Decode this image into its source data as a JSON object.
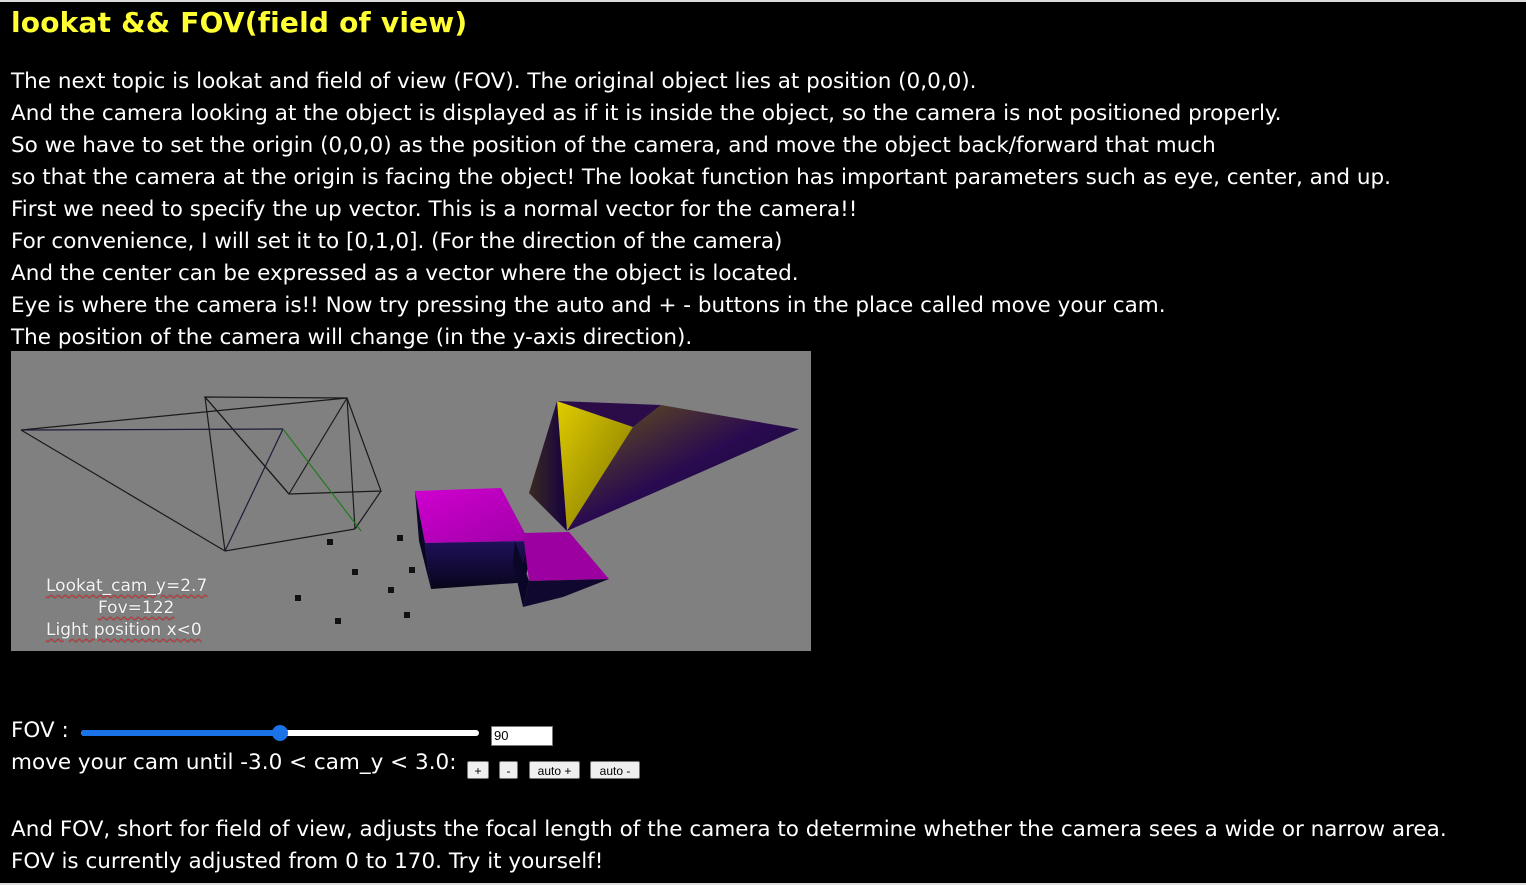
{
  "title": "lookat && FOV(field of view)",
  "intro_lines": [
    "The next topic is lookat and field of view (FOV). The original object lies at position (0,0,0).",
    "And the camera looking at the object is displayed as if it is inside the object, so the camera is not positioned properly.",
    "So we have to set the origin (0,0,0) as the position of the camera, and move the object back/forward that much",
    "so that the camera at the origin is facing the object! The lookat function has important parameters such as eye, center, and up.",
    "First we need to specify the up vector. This is a normal vector for the camera!!",
    "For convenience, I will set it to [0,1,0]. (For the direction of the camera)",
    "And the center can be expressed as a vector where the object is located.",
    "Eye is where the camera is!! Now try pressing the auto and + - buttons in the place called move your cam.",
    "The position of the camera will change (in the y-axis direction)."
  ],
  "canvas": {
    "overlay": {
      "cam_label": "Lookat_cam_y=2.7",
      "fov_label": "Fov=122",
      "light_label": "Light position x<0"
    }
  },
  "controls": {
    "fov_label": "FOV :",
    "fov_value": "90",
    "fov_min": 0,
    "fov_max": 170,
    "fov_slider_fraction": 0.5,
    "cam_label": "move your cam until -3.0 < cam_y < 3.0:",
    "plus_label": "+",
    "minus_label": "-",
    "auto_plus_label": "auto +",
    "auto_minus_label": "auto -"
  },
  "outro_lines": [
    "And FOV, short for field of view, adjusts the focal length of the camera to determine whether the camera sees a wide or narrow area.",
    "FOV is currently adjusted from 0 to 170. Try it yourself!"
  ],
  "colors": {
    "title": "#ffff33",
    "background": "#000000",
    "canvas_bg": "#808080",
    "slider_accent": "#1a73e8",
    "cube_magenta": "#c000c0",
    "pyramid_yellow": "#d4c000"
  }
}
